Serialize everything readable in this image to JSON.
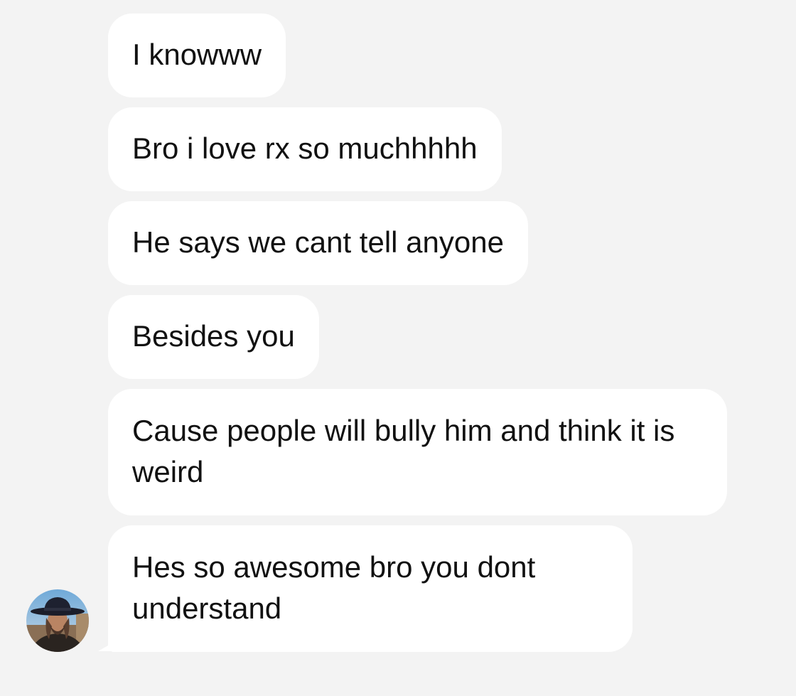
{
  "conversation": {
    "messages": [
      {
        "text": "I knowww"
      },
      {
        "text": "Bro i love rx so muchhhhh"
      },
      {
        "text": "He says we cant tell anyone"
      },
      {
        "text": "Besides you"
      },
      {
        "text": "Cause people will bully him and think it is weird"
      },
      {
        "text": "Hes so awesome bro you dont understand"
      }
    ],
    "sender_avatar": {
      "icon": "profile-photo-cowboy-hat"
    }
  },
  "colors": {
    "background": "#f3f3f3",
    "bubble": "#ffffff",
    "text": "#111111"
  }
}
